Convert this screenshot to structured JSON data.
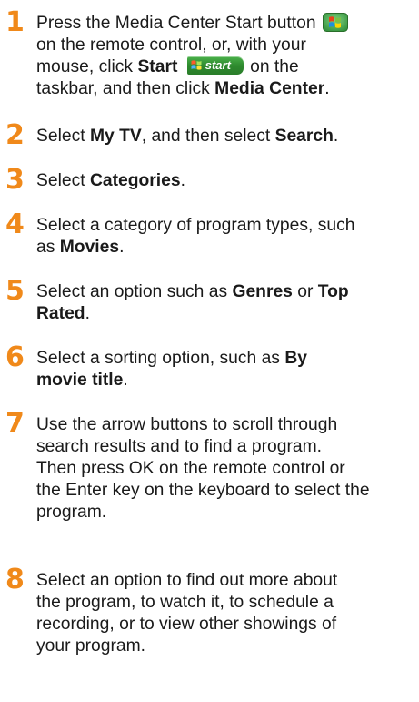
{
  "accent_color": "#f0891a",
  "steps": [
    {
      "number": "1",
      "l1": "Press the Media Center Start button",
      "l2": "on the remote control, or, with your",
      "l3a": "mouse, click ",
      "l3b": "Start",
      "l3c": "on the",
      "l4a": "taskbar, and then click ",
      "l4b": "Media Center",
      "l4c": "."
    },
    {
      "number": "2",
      "a": "Select ",
      "b": "My TV",
      "c": ", and then select ",
      "d": "Search",
      "e": "."
    },
    {
      "number": "3",
      "a": "Select ",
      "b": "Categories",
      "c": "."
    },
    {
      "number": "4",
      "l1": "Select a category of program types, such",
      "l2a": "as ",
      "l2b": "Movies",
      "l2c": "."
    },
    {
      "number": "5",
      "l1a": "Select an option such as ",
      "l1b": "Genres",
      "l1c": " or ",
      "l1d": "Top",
      "l2a": "Rated",
      "l2b": "."
    },
    {
      "number": "6",
      "l1a": "Select a sorting option, such as ",
      "l1b": "By",
      "l2a": "movie title",
      "l2b": "."
    },
    {
      "number": "7",
      "lines": [
        "Use the arrow buttons to scroll through",
        "search results and to find a program.",
        "Then press OK on the remote control or",
        "the Enter key on the keyboard to select the",
        "program."
      ]
    },
    {
      "number": "8",
      "lines": [
        "Select an option to find out more about",
        "the program, to watch it, to schedule a",
        "recording, or to view other showings of",
        "your program."
      ]
    }
  ],
  "icons": {
    "media_center_button": "windows-logo-icon",
    "start_button": "start-button-icon",
    "start_button_text": "start"
  }
}
